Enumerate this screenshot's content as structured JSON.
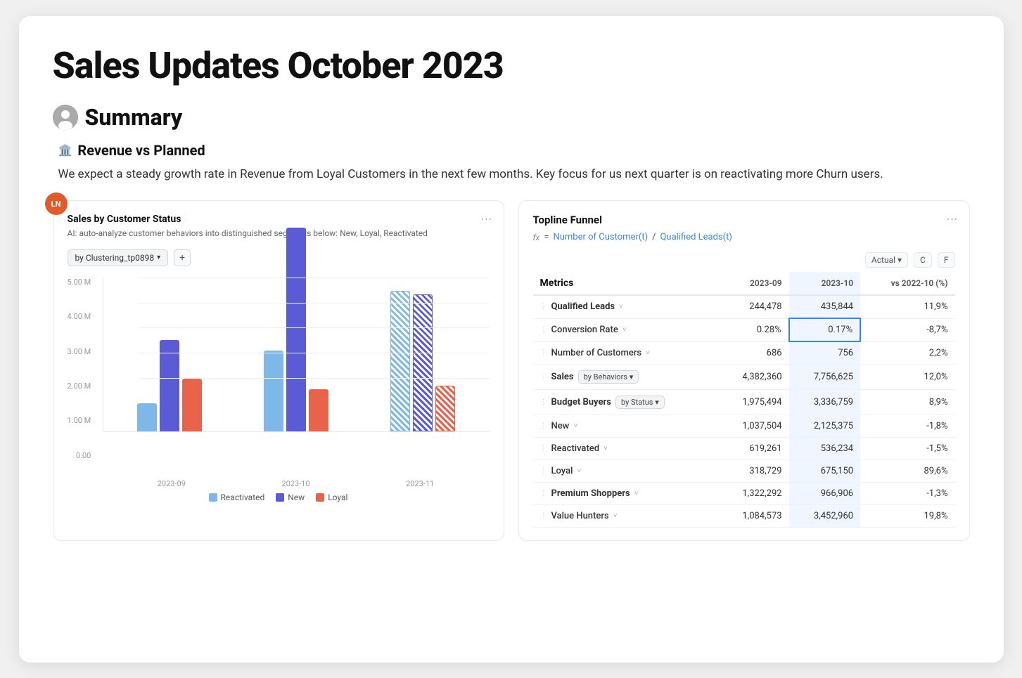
{
  "page": {
    "title": "Sales Updates October 2023",
    "section": {
      "label": "Summary",
      "avatar_text": "👤",
      "subsection_icon": "🏛️",
      "subsection_title": "Revenue vs Planned",
      "description": "We expect a steady growth rate in Revenue from Loyal Customers in the next few months. Key focus for us next quarter is on reactivating more Churn users."
    }
  },
  "left_chart": {
    "title": "Sales by Customer Status",
    "subtitle": "AI: auto-analyze customer behaviors into distinguished segments below: New, Loyal, Reactivated",
    "filter_label": "by Clustering_tp0898",
    "more_icon": "⋯",
    "y_labels": [
      "5.00 M",
      "4.00 M",
      "3.00 M",
      "2.00 M",
      "1.00 M",
      "0.00"
    ],
    "x_labels": [
      "2023-09",
      "2023-10",
      "2023-11"
    ],
    "bars": [
      {
        "group": "2023-09",
        "reactivated": 40,
        "new": 130,
        "loyal": 75
      },
      {
        "group": "2023-10",
        "reactivated": 115,
        "new": 290,
        "loyal": 60
      },
      {
        "group": "2023-11",
        "reactivated": 200,
        "new": 195,
        "loyal": 65
      }
    ],
    "legend": [
      {
        "label": "Reactivated",
        "color": "#7eb8e8"
      },
      {
        "label": "New",
        "color": "#5b5bd6"
      },
      {
        "label": "Loyal",
        "color": "#e8634a"
      }
    ]
  },
  "right_table": {
    "title": "Topline Funnel",
    "formula": "= Number of Customer(t) / Qualified Leads(t)",
    "formula_parts": [
      "Number of Customer(t)",
      "Qualified Leads(t)"
    ],
    "controls": [
      "Actual",
      "C",
      "F"
    ],
    "headers": [
      "Metrics",
      "2023-09",
      "2023-10",
      "vs 2022-10 (%)"
    ],
    "rows": [
      {
        "name": "Qualified Leads",
        "chevron": true,
        "bold": true,
        "val_09": "244,478",
        "val_10": "435,844",
        "vs": "11,9%",
        "vs_positive": true
      },
      {
        "name": "Conversion Rate",
        "chevron": true,
        "bold": false,
        "val_09": "0.28%",
        "val_10": "0.17%",
        "vs": "-8,7%",
        "vs_positive": false,
        "selected": true
      },
      {
        "name": "Number of Customers",
        "chevron": true,
        "bold": false,
        "val_09": "686",
        "val_10": "756",
        "vs": "2,2%",
        "vs_positive": true
      },
      {
        "name": "Sales",
        "chevron": false,
        "badge": "by Behaviors",
        "bold": true,
        "val_09": "4,382,360",
        "val_10": "7,756,625",
        "vs": "12,0%",
        "vs_positive": true
      },
      {
        "name": "Budget Buyers",
        "chevron": false,
        "badge": "by Status",
        "bold": true,
        "val_09": "1,975,494",
        "val_10": "3,336,759",
        "vs": "8,9%",
        "vs_positive": true
      },
      {
        "name": "New",
        "chevron": true,
        "bold": false,
        "val_09": "1,037,504",
        "val_10": "2,125,375",
        "vs": "-1,8%",
        "vs_positive": false
      },
      {
        "name": "Reactivated",
        "chevron": true,
        "bold": false,
        "val_09": "619,261",
        "val_10": "536,234",
        "vs": "-1,5%",
        "vs_positive": false
      },
      {
        "name": "Loyal",
        "chevron": true,
        "bold": false,
        "val_09": "318,729",
        "val_10": "675,150",
        "vs": "89,6%",
        "vs_positive": true
      },
      {
        "name": "Premium Shoppers",
        "chevron": true,
        "bold": true,
        "val_09": "1,322,292",
        "val_10": "966,906",
        "vs": "-1,3%",
        "vs_positive": false
      },
      {
        "name": "Value Hunters",
        "chevron": true,
        "bold": false,
        "val_09": "1,084,573",
        "val_10": "3,452,960",
        "vs": "19,8%",
        "vs_positive": true
      }
    ]
  }
}
